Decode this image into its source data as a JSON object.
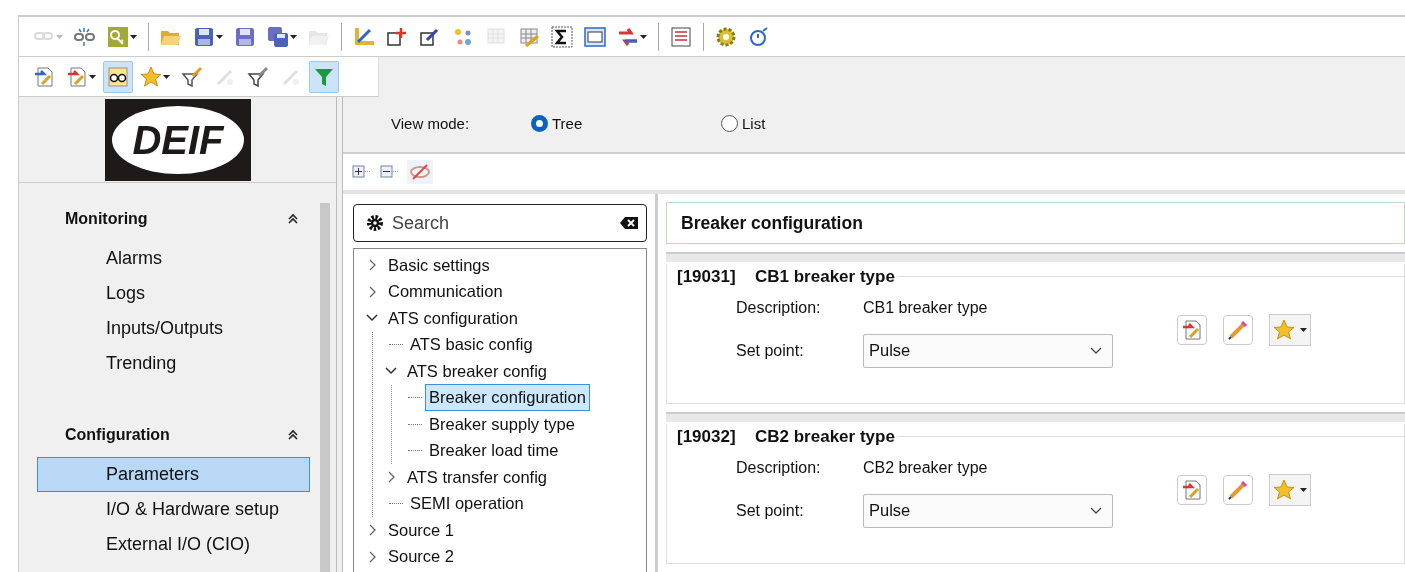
{
  "toolbars": [
    [
      {
        "kind": "icon",
        "disabled": true,
        "dropdown": true,
        "pressed": false
      },
      {
        "kind": "icon",
        "disabled": false,
        "dropdown": false,
        "pressed": false
      },
      {
        "kind": "icon",
        "disabled": false,
        "dropdown": true,
        "pressed": false
      },
      {
        "kind": "separator"
      },
      {
        "kind": "icon",
        "disabled": false,
        "dropdown": false,
        "pressed": false
      },
      {
        "kind": "icon",
        "disabled": false,
        "dropdown": true,
        "pressed": false
      },
      {
        "kind": "icon",
        "disabled": false,
        "dropdown": false,
        "pressed": false
      },
      {
        "kind": "icon",
        "disabled": false,
        "dropdown": true,
        "pressed": false
      },
      {
        "kind": "icon",
        "disabled": true,
        "dropdown": false,
        "pressed": false
      },
      {
        "kind": "separator"
      },
      {
        "kind": "icon",
        "disabled": false,
        "dropdown": false,
        "pressed": false
      },
      {
        "kind": "icon",
        "disabled": false,
        "dropdown": false,
        "pressed": false
      },
      {
        "kind": "icon",
        "disabled": false,
        "dropdown": false,
        "pressed": false
      },
      {
        "kind": "icon",
        "disabled": false,
        "dropdown": false,
        "pressed": false
      },
      {
        "kind": "icon",
        "disabled": true,
        "dropdown": false,
        "pressed": false
      },
      {
        "kind": "icon",
        "disabled": false,
        "dropdown": false,
        "pressed": false
      },
      {
        "kind": "icon",
        "disabled": false,
        "dropdown": false,
        "pressed": false
      },
      {
        "kind": "icon",
        "disabled": false,
        "dropdown": false,
        "pressed": false
      },
      {
        "kind": "icon",
        "disabled": false,
        "dropdown": true,
        "pressed": false
      },
      {
        "kind": "separator"
      },
      {
        "kind": "icon",
        "disabled": false,
        "dropdown": false,
        "pressed": false
      },
      {
        "kind": "separator"
      },
      {
        "kind": "icon",
        "disabled": false,
        "dropdown": false,
        "pressed": false
      },
      {
        "kind": "icon",
        "disabled": false,
        "dropdown": false,
        "pressed": false
      }
    ],
    [
      {
        "kind": "icon",
        "disabled": false,
        "dropdown": false,
        "pressed": false
      },
      {
        "kind": "icon",
        "disabled": false,
        "dropdown": true,
        "pressed": false
      },
      {
        "kind": "icon",
        "disabled": false,
        "dropdown": false,
        "pressed": true
      },
      {
        "kind": "icon",
        "disabled": false,
        "dropdown": true,
        "pressed": false
      },
      {
        "kind": "icon",
        "disabled": false,
        "dropdown": false,
        "pressed": false
      },
      {
        "kind": "icon",
        "disabled": true,
        "dropdown": false,
        "pressed": false
      },
      {
        "kind": "icon",
        "disabled": false,
        "dropdown": false,
        "pressed": false
      },
      {
        "kind": "icon",
        "disabled": true,
        "dropdown": false,
        "pressed": false
      },
      {
        "kind": "icon",
        "disabled": false,
        "dropdown": false,
        "pressed": true
      }
    ]
  ],
  "logo": {
    "text": "DEIF"
  },
  "sidebar": {
    "sections": [
      {
        "title": "Monitoring",
        "expanded": true,
        "items": [
          {
            "label": "Alarms",
            "selected": false
          },
          {
            "label": "Logs",
            "selected": false
          },
          {
            "label": "Inputs/Outputs",
            "selected": false
          },
          {
            "label": "Trending",
            "selected": false
          }
        ]
      },
      {
        "title": "Configuration",
        "expanded": true,
        "items": [
          {
            "label": "Parameters",
            "selected": true
          },
          {
            "label": "I/O & Hardware setup",
            "selected": false
          },
          {
            "label": "External I/O (CIO)",
            "selected": false
          }
        ]
      }
    ]
  },
  "view_mode": {
    "label": "View mode:",
    "options": [
      {
        "label": "Tree",
        "selected": true
      },
      {
        "label": "List",
        "selected": false
      }
    ]
  },
  "search": {
    "placeholder": "Search"
  },
  "tree": [
    {
      "label": "Basic settings",
      "expanded": false,
      "selected": false
    },
    {
      "label": "Communication",
      "expanded": false,
      "selected": false
    },
    {
      "label": "ATS configuration",
      "expanded": true,
      "selected": false,
      "children": [
        {
          "label": "ATS basic config",
          "selected": false
        },
        {
          "label": "ATS breaker config",
          "expanded": true,
          "selected": false,
          "children": [
            {
              "label": "Breaker configuration",
              "selected": true
            },
            {
              "label": "Breaker supply type",
              "selected": false
            },
            {
              "label": "Breaker load time",
              "selected": false
            }
          ]
        },
        {
          "label": "ATS transfer config",
          "expanded": false,
          "selected": false
        },
        {
          "label": "SEMI operation",
          "selected": false
        }
      ]
    },
    {
      "label": "Source 1",
      "expanded": false,
      "selected": false
    },
    {
      "label": "Source 2",
      "expanded": false,
      "selected": false
    }
  ],
  "panel": {
    "title": "Breaker configuration",
    "parameters": [
      {
        "id": "[19031]",
        "name": "CB1 breaker type",
        "description_label": "Description:",
        "description": "CB1 breaker type",
        "setpoint_label": "Set point:",
        "value": "Pulse"
      },
      {
        "id": "[19032]",
        "name": "CB2 breaker type",
        "description_label": "Description:",
        "description": "CB2 breaker type",
        "setpoint_label": "Set point:",
        "value": "Pulse"
      }
    ]
  }
}
